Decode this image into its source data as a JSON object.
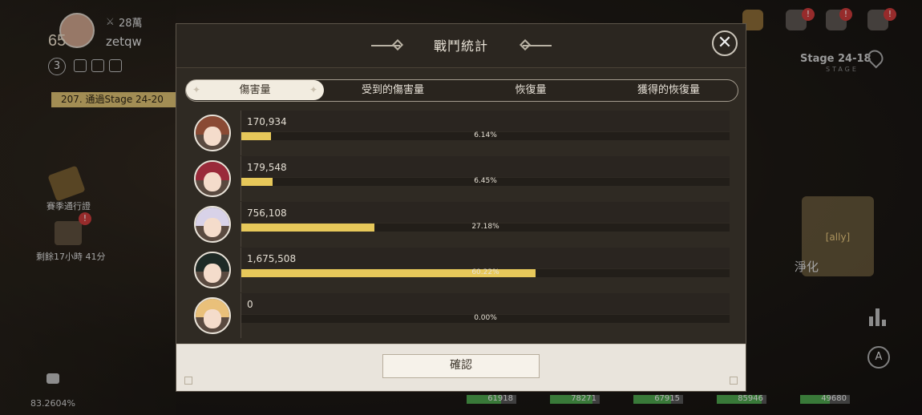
{
  "player": {
    "level": "65",
    "power": "28萬",
    "name": "zetqw",
    "rank": "3"
  },
  "quest": {
    "label": "207. 通過Stage 24-20"
  },
  "side": {
    "season_pass": "賽季通行證",
    "timer": "剩餘17小時 41分",
    "percent": "83.2604%",
    "badge": "!"
  },
  "stage": {
    "label": "Stage 24-18",
    "sub": "STAGE"
  },
  "ally": {
    "skill_label": "淨化",
    "auto_label": "A"
  },
  "hp_values": [
    "61918",
    "78271",
    "67915",
    "85946",
    "49680"
  ],
  "modal": {
    "title": "戰鬥統計",
    "close_symbol": "✕",
    "tabs": [
      "傷害量",
      "受到的傷害量",
      "恢復量",
      "獲得的恢復量"
    ],
    "active_tab": 0,
    "confirm_label": "確認"
  },
  "rows": [
    {
      "value": "170,934",
      "percent": "6.14%",
      "ratio": 0.0614,
      "hair": "#8a4a34"
    },
    {
      "value": "179,548",
      "percent": "6.45%",
      "ratio": 0.0645,
      "hair": "#9a2a3a"
    },
    {
      "value": "756,108",
      "percent": "27.18%",
      "ratio": 0.2718,
      "hair": "#d8d2e8"
    },
    {
      "value": "1,675,508",
      "percent": "60.22%",
      "ratio": 0.6022,
      "hair": "#1e2a26"
    },
    {
      "value": "0",
      "percent": "0.00%",
      "ratio": 0.0,
      "hair": "#e9c07a"
    }
  ],
  "colors": {
    "bar_fill": "#e7c85a",
    "accent": "#d9bd70"
  }
}
